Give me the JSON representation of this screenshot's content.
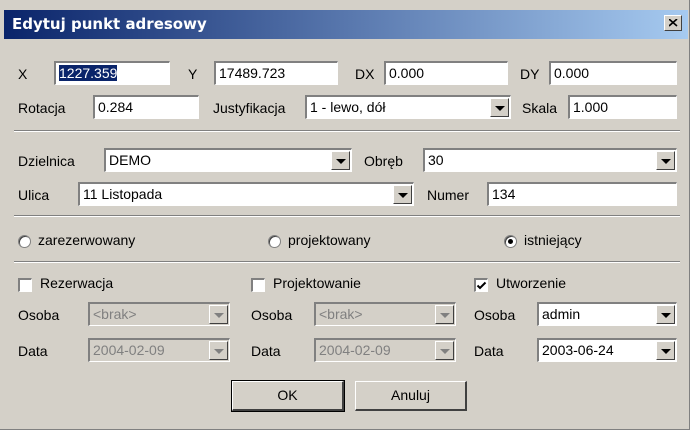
{
  "window": {
    "title": "Edytuj punkt adresowy"
  },
  "coords": {
    "x_label": "X",
    "x_value": "1227.359",
    "y_label": "Y",
    "y_value": "17489.723",
    "dx_label": "DX",
    "dx_value": "0.000",
    "dy_label": "DY",
    "dy_value": "0.000"
  },
  "attrs": {
    "rotation_label": "Rotacja",
    "rotation_value": "0.284",
    "justification_label": "Justyfikacja",
    "justification_value": "1 - lewo, dół",
    "scale_label": "Skala",
    "scale_value": "1.000"
  },
  "location": {
    "district_label": "Dzielnica",
    "district_value": "DEMO",
    "precinct_label": "Obręb",
    "precinct_value": "30",
    "street_label": "Ulica",
    "street_value": "11 Listopada",
    "number_label": "Numer",
    "number_value": "134"
  },
  "status": {
    "options": [
      "zarezerwowany",
      "projektowany",
      "istniejący"
    ],
    "selected": "istniejący"
  },
  "history": {
    "reservation": {
      "label": "Rezerwacja",
      "checked": false,
      "person_label": "Osoba",
      "person_value": "<brak>",
      "date_label": "Data",
      "date_value": "2004-02-09"
    },
    "design": {
      "label": "Projektowanie",
      "checked": false,
      "person_label": "Osoba",
      "person_value": "<brak>",
      "date_label": "Data",
      "date_value": "2004-02-09"
    },
    "creation": {
      "label": "Utworzenie",
      "checked": true,
      "person_label": "Osoba",
      "person_value": "admin",
      "date_label": "Data",
      "date_value": "2003-06-24"
    }
  },
  "buttons": {
    "ok_label": "OK",
    "cancel_label": "Anuluj"
  }
}
